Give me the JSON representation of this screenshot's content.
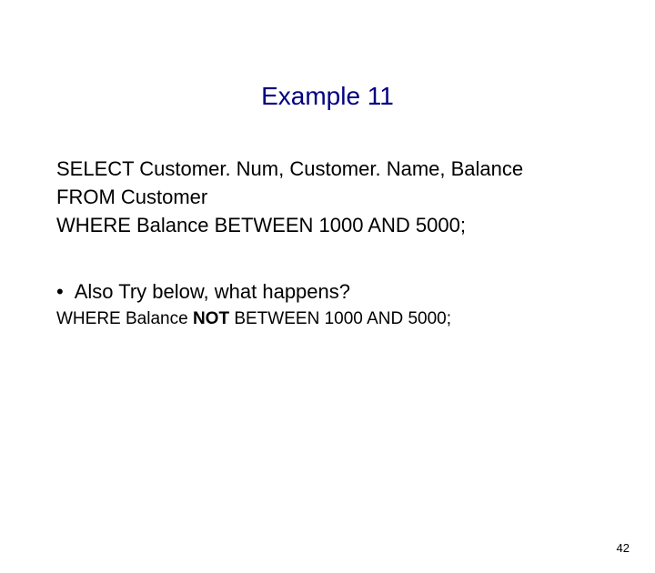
{
  "title": "Example 11",
  "sql": {
    "line1": "SELECT Customer. Num, Customer. Name, Balance",
    "line2": "FROM Customer",
    "line3": "WHERE Balance BETWEEN 1000 AND 5000;"
  },
  "bullet": {
    "marker": "•",
    "text": "Also Try below, what happens?"
  },
  "note": {
    "prefix": "WHERE Balance ",
    "bold": "NOT",
    "suffix": " BETWEEN 1000 AND 5000;"
  },
  "pageNumber": "42"
}
